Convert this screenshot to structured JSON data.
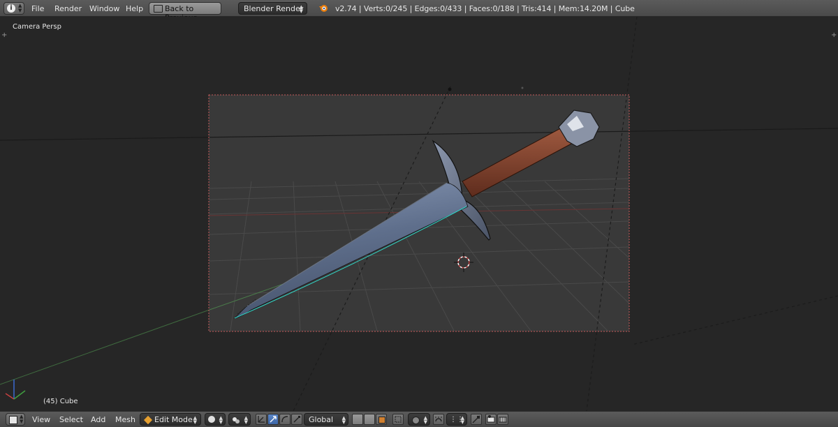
{
  "header": {
    "menu": [
      "File",
      "Render",
      "Window",
      "Help"
    ],
    "back_button": "Back to Previous",
    "render_engine": "Blender Render",
    "stats": "v2.74 | Verts:0/245 | Edges:0/433 | Faces:0/188 | Tris:414 | Mem:14.20M | Cube"
  },
  "viewport": {
    "view_label": "Camera Persp",
    "object_label": "(45) Cube"
  },
  "footer": {
    "menu": [
      "View",
      "Select",
      "Add",
      "Mesh"
    ],
    "mode": "Edit Mode",
    "orientation": "Global"
  },
  "colors": {
    "header_bg": "#4f4f4f",
    "viewport_bg": "#393939",
    "camera_frame": "#d06060",
    "blade": "#6f7f9c",
    "handle": "#7a3d2a",
    "selection_edge": "#2fd8c8"
  },
  "icons": [
    "info-icon",
    "blender-logo-icon",
    "cube-icon",
    "sphere-shading-icon",
    "pivot-icon",
    "manipulator-icon",
    "translate-icon",
    "rotate-icon",
    "scale-icon",
    "vertex-select-icon",
    "edge-select-icon",
    "face-select-icon",
    "snap-icon",
    "proportional-icon",
    "render-icon"
  ]
}
